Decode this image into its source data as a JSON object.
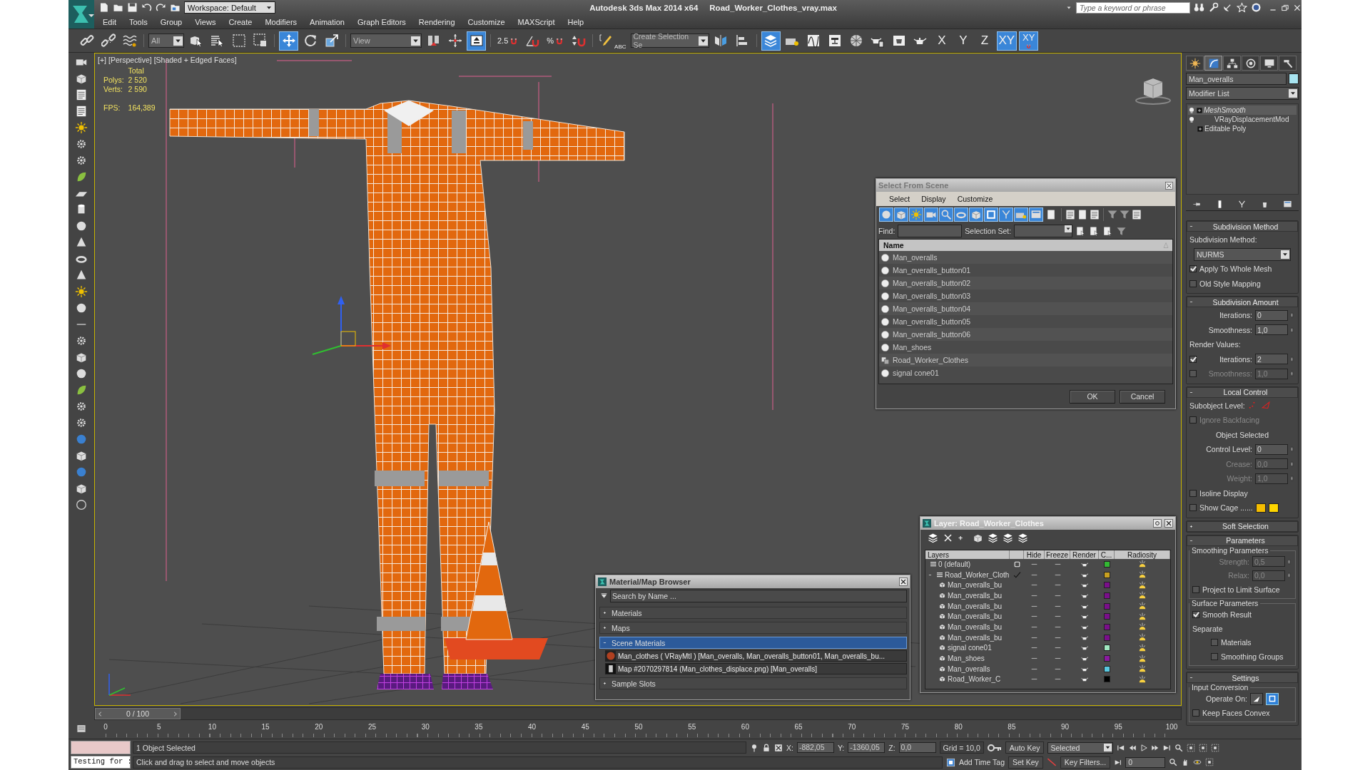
{
  "window": {
    "title": "Autodesk 3ds Max  2014 x64",
    "file": "Road_Worker_Clothes_vray.max",
    "workspace": "Workspace: Default",
    "search_placeholder": "Type a keyword or phrase"
  },
  "menu": [
    "Edit",
    "Tools",
    "Group",
    "Views",
    "Create",
    "Modifiers",
    "Animation",
    "Graph Editors",
    "Rendering",
    "Customize",
    "MAXScript",
    "Help"
  ],
  "toolbar": {
    "items": [
      {
        "kind": "link",
        "selected": false
      },
      {
        "kind": "unlink",
        "selected": false
      },
      {
        "kind": "bind",
        "selected": false
      },
      {
        "kind": "dropdown",
        "label": "All"
      },
      {
        "kind": "select",
        "selected": false
      },
      {
        "kind": "select_by_name",
        "selected": false
      },
      {
        "kind": "region",
        "selected": false
      },
      {
        "kind": "crossing",
        "selected": false
      },
      {
        "kind": "move",
        "selected": true
      },
      {
        "kind": "rotate",
        "selected": false
      },
      {
        "kind": "scale",
        "selected": false
      },
      {
        "kind": "dropdown",
        "label": "View"
      },
      {
        "kind": "pivot",
        "selected": false
      },
      {
        "kind": "manipulate",
        "selected": false
      },
      {
        "kind": "keyboard",
        "selected": true
      },
      {
        "kind": "snap",
        "selected": false,
        "label": "2.5"
      },
      {
        "kind": "angle_snap",
        "selected": false
      },
      {
        "kind": "snap",
        "selected": false,
        "label": "%"
      },
      {
        "kind": "spinner_snap",
        "selected": false
      },
      {
        "kind": "edit_named",
        "selected": false,
        "label": "ABC"
      },
      {
        "kind": "dropdown",
        "label": "Create Selection Se"
      },
      {
        "kind": "mirror",
        "selected": false
      },
      {
        "kind": "align",
        "selected": false
      },
      {
        "kind": "layers",
        "selected": true
      },
      {
        "kind": "explorer",
        "selected": false
      },
      {
        "kind": "curve",
        "selected": false
      },
      {
        "kind": "schematic",
        "selected": false
      },
      {
        "kind": "material",
        "selected": false
      },
      {
        "kind": "render_setup",
        "selected": false
      },
      {
        "kind": "render_frame",
        "selected": false
      },
      {
        "kind": "render",
        "selected": false
      },
      {
        "kind": "axis",
        "label": "X",
        "selected": false
      },
      {
        "kind": "axis",
        "label": "Y",
        "selected": false
      },
      {
        "kind": "axis",
        "label": "Z",
        "selected": false
      },
      {
        "kind": "axis",
        "label": "XY",
        "selected": true
      },
      {
        "kind": "axis_snap",
        "label": "XY",
        "selected": true
      }
    ]
  },
  "viewport": {
    "labels": [
      "[+]",
      "[Perspective]",
      "[Shaded + Edged Faces]"
    ],
    "stats": {
      "heading": "Total",
      "rows": [
        {
          "label": "Polys:",
          "value": "2 520"
        },
        {
          "label": "Verts:",
          "value": "2 590"
        },
        {
          "label": "FPS:",
          "value": "164,389"
        }
      ]
    }
  },
  "select_from_scene": {
    "title": "Select From Scene",
    "menu": [
      "Select",
      "Display",
      "Customize"
    ],
    "filters": [
      {
        "kind": "geometry",
        "selected": true
      },
      {
        "kind": "shapes",
        "selected": true
      },
      {
        "kind": "lights",
        "selected": true
      },
      {
        "kind": "cameras",
        "selected": true
      },
      {
        "kind": "helpers",
        "selected": true
      },
      {
        "kind": "spacewarps",
        "selected": true
      },
      {
        "kind": "groups",
        "selected": true
      },
      {
        "kind": "xrefs",
        "selected": true
      },
      {
        "kind": "bones",
        "selected": true
      },
      {
        "kind": "containers",
        "selected": true
      },
      {
        "kind": "frozen",
        "selected": true
      },
      {
        "kind": "hidden",
        "selected": false
      }
    ],
    "find_label": "Find:",
    "selection_set_label": "Selection Set:",
    "column": "Name",
    "rows": [
      {
        "name": "Man_overalls",
        "kind": "object"
      },
      {
        "name": "Man_overalls_button01",
        "kind": "object"
      },
      {
        "name": "Man_overalls_button02",
        "kind": "object"
      },
      {
        "name": "Man_overalls_button03",
        "kind": "object"
      },
      {
        "name": "Man_overalls_button04",
        "kind": "object"
      },
      {
        "name": "Man_overalls_button05",
        "kind": "object"
      },
      {
        "name": "Man_overalls_button06",
        "kind": "object"
      },
      {
        "name": "Man_shoes",
        "kind": "object"
      },
      {
        "name": "Road_Worker_Clothes",
        "kind": "group"
      },
      {
        "name": "signal cone01",
        "kind": "object"
      }
    ],
    "buttons": [
      "OK",
      "Cancel"
    ]
  },
  "layer_manager": {
    "title": "Layer: Road_Worker_Clothes",
    "columns": [
      "Layers",
      "Hide",
      "Freeze",
      "Render",
      "C...",
      "Radiosity"
    ],
    "layers": [
      {
        "name": "0 (default)",
        "active": false,
        "color": "#33b833"
      },
      {
        "name": "Road_Worker_Cloth",
        "active": true,
        "expanded": true,
        "color": "#c8a020",
        "children": [
          {
            "name": "Man_overalls_bu",
            "color": "#7a0f8a"
          },
          {
            "name": "Man_overalls_bu",
            "color": "#7a0f8a"
          },
          {
            "name": "Man_overalls_bu",
            "color": "#7a0f8a"
          },
          {
            "name": "Man_overalls_bu",
            "color": "#7a0f8a"
          },
          {
            "name": "Man_overalls_bu",
            "color": "#7a0f8a"
          },
          {
            "name": "Man_overalls_bu",
            "color": "#7a0f8a"
          },
          {
            "name": "signal cone01",
            "color": "#a0e8c0"
          },
          {
            "name": "Man_shoes",
            "color": "#8a1aa0"
          },
          {
            "name": "Man_overalls",
            "color": "#58c8e0"
          },
          {
            "name": "Road_Worker_C",
            "color": "#000000"
          }
        ]
      }
    ]
  },
  "material_browser": {
    "title": "Material/Map Browser",
    "search_placeholder": "Search by Name ...",
    "groups": [
      {
        "title": "Materials",
        "expanded": false,
        "selected": false
      },
      {
        "title": "Maps",
        "expanded": false,
        "selected": false
      },
      {
        "title": "Scene Materials",
        "expanded": true,
        "selected": true,
        "items": [
          {
            "kind": "material",
            "text": "Man_clothes ( VRayMtl ) [Man_overalls, Man_overalls_button01, Man_overalls_bu..."
          },
          {
            "kind": "map",
            "text": "Map #2070297814 (Man_clothes_displace.png) [Man_overalls]"
          }
        ]
      },
      {
        "title": "Sample Slots",
        "expanded": false,
        "selected": false
      }
    ]
  },
  "command_panel": {
    "tabs": [
      {
        "kind": "create",
        "selected": false
      },
      {
        "kind": "modify",
        "selected": true
      },
      {
        "kind": "hierarchy",
        "selected": false
      },
      {
        "kind": "motion",
        "selected": false
      },
      {
        "kind": "display",
        "selected": false
      },
      {
        "kind": "utilities",
        "selected": false
      }
    ],
    "object_name": "Man_overalls",
    "modifier_list": "Modifier List",
    "stack": [
      {
        "label": "MeshSmooth",
        "kind": "modifier",
        "expandable": true,
        "selected": true
      },
      {
        "label": "VRayDisplacementMod",
        "kind": "modifier",
        "expandable": false,
        "selected": false
      },
      {
        "label": "Editable Poly",
        "kind": "base",
        "expandable": true,
        "selected": false
      }
    ],
    "rollouts": [
      {
        "title": "Subdivision Method",
        "expanded": true,
        "controls": [
          {
            "kind": "label",
            "text": "Subdivision Method:"
          },
          {
            "kind": "dropdown",
            "value": "NURMS"
          },
          {
            "kind": "checkbox",
            "label": "Apply To Whole Mesh",
            "checked": true,
            "disabled": false
          },
          {
            "kind": "checkbox",
            "label": "Old Style Mapping",
            "checked": false,
            "disabled": false
          }
        ]
      },
      {
        "title": "Subdivision Amount",
        "expanded": true,
        "controls": [
          {
            "kind": "spinner",
            "label": "Iterations:",
            "value": "0",
            "disabled": false
          },
          {
            "kind": "spinner",
            "label": "Smoothness:",
            "value": "1,0",
            "disabled": false
          },
          {
            "kind": "label",
            "text": "Render Values:"
          },
          {
            "kind": "check_spinner",
            "label": "Iterations:",
            "value": "2",
            "checked": true
          },
          {
            "kind": "check_spinner",
            "label": "Smoothness:",
            "value": "1,0",
            "checked": false
          }
        ]
      },
      {
        "title": "Local Control",
        "expanded": true,
        "controls": [
          {
            "kind": "subobject",
            "label": "Subobject Level:"
          },
          {
            "kind": "checkbox",
            "label": "Ignore Backfacing",
            "checked": false,
            "disabled": true
          },
          {
            "kind": "caption",
            "text": "Object Selected"
          },
          {
            "kind": "spinner",
            "label": "Control Level:",
            "value": "0",
            "disabled": false
          },
          {
            "kind": "spinner",
            "label": "Crease:",
            "value": "0,0",
            "disabled": true
          },
          {
            "kind": "spinner",
            "label": "Weight:",
            "value": "1,0",
            "disabled": true
          },
          {
            "kind": "checkbox",
            "label": "Isoline Display",
            "checked": false,
            "disabled": false
          },
          {
            "kind": "cage",
            "label": "Show Cage ......",
            "checked": false,
            "swatches": [
              {
                "color": "#f5bd00"
              },
              {
                "color": "#ffd700"
              }
            ]
          }
        ]
      },
      {
        "title": "Soft Selection",
        "expanded": false
      },
      {
        "title": "Parameters",
        "expanded": true,
        "controls": [
          {
            "kind": "group",
            "title": "Smoothing Parameters",
            "controls": [
              {
                "kind": "spinner",
                "label": "Strength:",
                "value": "0,5",
                "disabled": true
              },
              {
                "kind": "spinner",
                "label": "Relax:",
                "value": "0,0",
                "disabled": true
              },
              {
                "kind": "checkbox",
                "label": "Project to Limit Surface",
                "checked": false,
                "disabled": false
              }
            ]
          },
          {
            "kind": "group",
            "title": "Surface Parameters",
            "controls": [
              {
                "kind": "checkbox",
                "label": "Smooth Result",
                "checked": true,
                "disabled": false
              },
              {
                "kind": "label",
                "text": "Separate"
              },
              {
                "kind": "sub_checkbox",
                "label": "Materials",
                "checked": false
              },
              {
                "kind": "sub_checkbox",
                "label": "Smoothing Groups",
                "checked": false
              }
            ]
          }
        ]
      },
      {
        "title": "Settings",
        "expanded": true,
        "controls": [
          {
            "kind": "group",
            "title": "Input Conversion",
            "controls": [
              {
                "kind": "operate_on",
                "label": "Operate On:",
                "options": [
                  {
                    "kind": "triangle",
                    "selected": false
                  },
                  {
                    "kind": "polygon",
                    "selected": true
                  }
                ]
              },
              {
                "kind": "checkbox",
                "label": "Keep Faces Convex",
                "checked": false,
                "disabled": false
              }
            ]
          }
        ]
      }
    ]
  },
  "timeline": {
    "position": "0 / 100",
    "level": 0,
    "ticks": [
      "0",
      "5",
      "10",
      "15",
      "20",
      "25",
      "30",
      "35",
      "40",
      "45",
      "50",
      "55",
      "60",
      "65",
      "70",
      "75",
      "80",
      "85",
      "90",
      "95",
      "100"
    ]
  },
  "status_bar": {
    "listener_input": "Testing for :",
    "selection": "1 Object Selected",
    "prompt": "Click and drag to select and move objects",
    "coords": [
      {
        "label": "X:",
        "value": "-882,05"
      },
      {
        "label": "Y:",
        "value": "-1360,05"
      },
      {
        "label": "Z:",
        "value": "0,0"
      }
    ],
    "grid": "Grid = 10,0",
    "time_tag": "Add Time Tag",
    "auto_key": "Auto Key",
    "key_mode": "Selected",
    "set_key": "Set Key",
    "key_filters": "Key Filters...",
    "frame": "0"
  }
}
